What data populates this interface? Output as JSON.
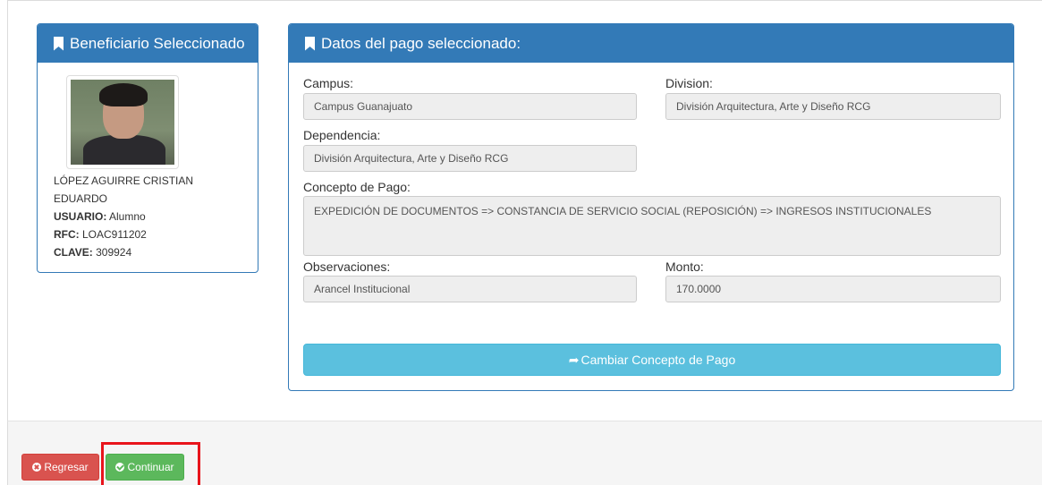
{
  "beneficiary_panel": {
    "title": "Beneficiario Seleccionado",
    "name_line1": "LÓPEZ AGUIRRE CRISTIAN",
    "name_line2": "EDUARDO",
    "usuario_label": "USUARIO:",
    "usuario_value": " Alumno",
    "rfc_label": "RFC:",
    "rfc_value": " LOAC911202",
    "clave_label": "CLAVE:",
    "clave_value": " 309924"
  },
  "payment_panel": {
    "title": "Datos del pago seleccionado:",
    "campus_label": "Campus:",
    "campus_value": "Campus Guanajuato",
    "division_label": "Division:",
    "division_value": "División Arquitectura, Arte y Diseño RCG",
    "dependencia_label": "Dependencia:",
    "dependencia_value": "División Arquitectura, Arte y Diseño RCG",
    "concepto_label": "Concepto de Pago:",
    "concepto_value": "EXPEDICIÓN DE DOCUMENTOS => CONSTANCIA DE SERVICIO SOCIAL (REPOSICIÓN) => INGRESOS INSTITUCIONALES",
    "observaciones_label": "Observaciones:",
    "observaciones_value": "Arancel Institucional",
    "monto_label": "Monto:",
    "monto_value": "170.0000",
    "change_button": "Cambiar Concepto de Pago"
  },
  "footer": {
    "back_button": "Regresar",
    "continue_button": "Continuar"
  },
  "colors": {
    "primary": "#337ab7",
    "info": "#5bc0de",
    "danger": "#d9534f",
    "success": "#5cb85c",
    "highlight": "#e8141b"
  }
}
